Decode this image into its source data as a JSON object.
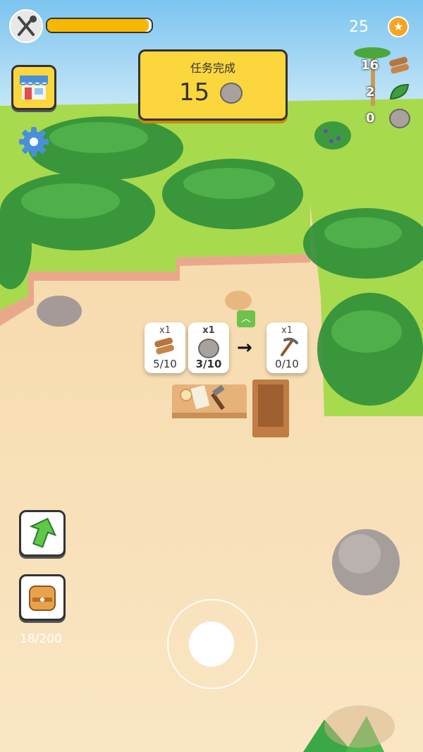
{
  "hud": {
    "hunger_icon": "fork-knife-icon",
    "hunger_fill": 0.97,
    "coins": "25",
    "coin_icon": "star-coin-icon"
  },
  "quest": {
    "title": "任务完成",
    "count": "15",
    "item_icon": "stone-icon"
  },
  "resources": [
    {
      "value": "16",
      "icon": "wood-log-icon"
    },
    {
      "value": "2",
      "icon": "leaf-icon"
    },
    {
      "value": "0",
      "icon": "stone-icon"
    }
  ],
  "buttons": {
    "shop_icon": "shop-icon",
    "settings_icon": "gear-icon",
    "upgrade_icon": "up-arrow-icon",
    "backpack_icon": "backpack-icon"
  },
  "backpack_capacity": "18/200",
  "recipe": {
    "inputs": [
      {
        "multiplier": "x1",
        "count": "5/10",
        "icon": "wood-log-icon"
      },
      {
        "multiplier": "x1",
        "count": "3/10",
        "icon": "stone-icon"
      }
    ],
    "arrow": "→",
    "output": {
      "multiplier": "x1",
      "count": "0/10",
      "icon": "pickaxe-icon"
    }
  },
  "colors": {
    "sky": "#9fd3f2",
    "grass": "#a6d94a",
    "sand": "#f7dfb5",
    "quest_bg": "#fbd63d",
    "hunger_bar": "#f7b800",
    "coin": "#f5a623"
  }
}
